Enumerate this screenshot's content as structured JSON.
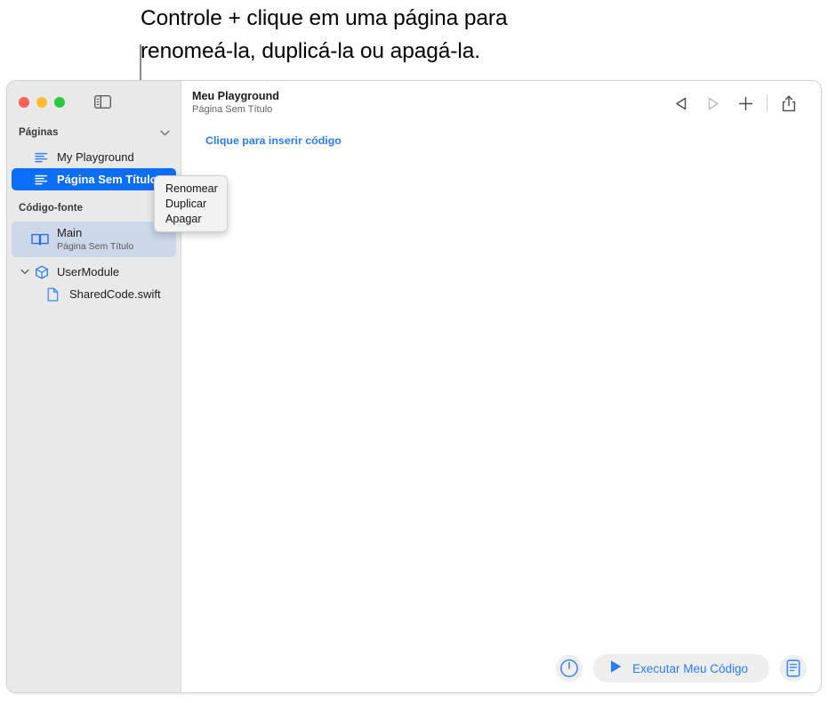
{
  "callout": {
    "text": "Controle + clique em uma página para\nrenomeá-la, duplicá-la ou apagá-la."
  },
  "window": {
    "sidebar": {
      "sections": [
        {
          "title": "Páginas",
          "chevron": "chevron-down-icon",
          "items": [
            {
              "label": "My Playground",
              "icon": "page-lines-icon",
              "selected": false
            },
            {
              "label": "Página Sem Título",
              "icon": "page-lines-icon",
              "selected": true
            }
          ]
        },
        {
          "title": "Código-fonte",
          "items": [
            {
              "label": "Main",
              "sublabel": "Página Sem Título",
              "icon": "book-icon",
              "highlighted": true
            },
            {
              "label": "UserModule",
              "icon": "package-cube-icon",
              "expanded": true
            },
            {
              "label": "SharedCode.swift",
              "icon": "swift-file-icon",
              "child": true
            }
          ]
        }
      ]
    },
    "main": {
      "document_title": "Meu Playground",
      "document_subtitle": "Página Sem Título",
      "insert_code_link": "Clique para inserir código",
      "toolbar": {
        "back": "back-triangle-icon",
        "forward": "forward-triangle-icon",
        "add": "plus-icon",
        "share": "share-icon"
      },
      "bottom": {
        "gauge_label": "gauge-icon",
        "run_label": "Executar Meu Código",
        "run_icon": "play-triangle-icon",
        "console_label": "console-document-icon"
      }
    },
    "context_menu": {
      "items": [
        "Renomear",
        "Duplicar",
        "Apagar"
      ]
    }
  },
  "colors": {
    "selection_blue": "#0b6ef7",
    "accent_blue": "#2b7cf6",
    "sidebar_bg": "#e9e9e9",
    "main_row_highlight": "#ccd7ea"
  }
}
